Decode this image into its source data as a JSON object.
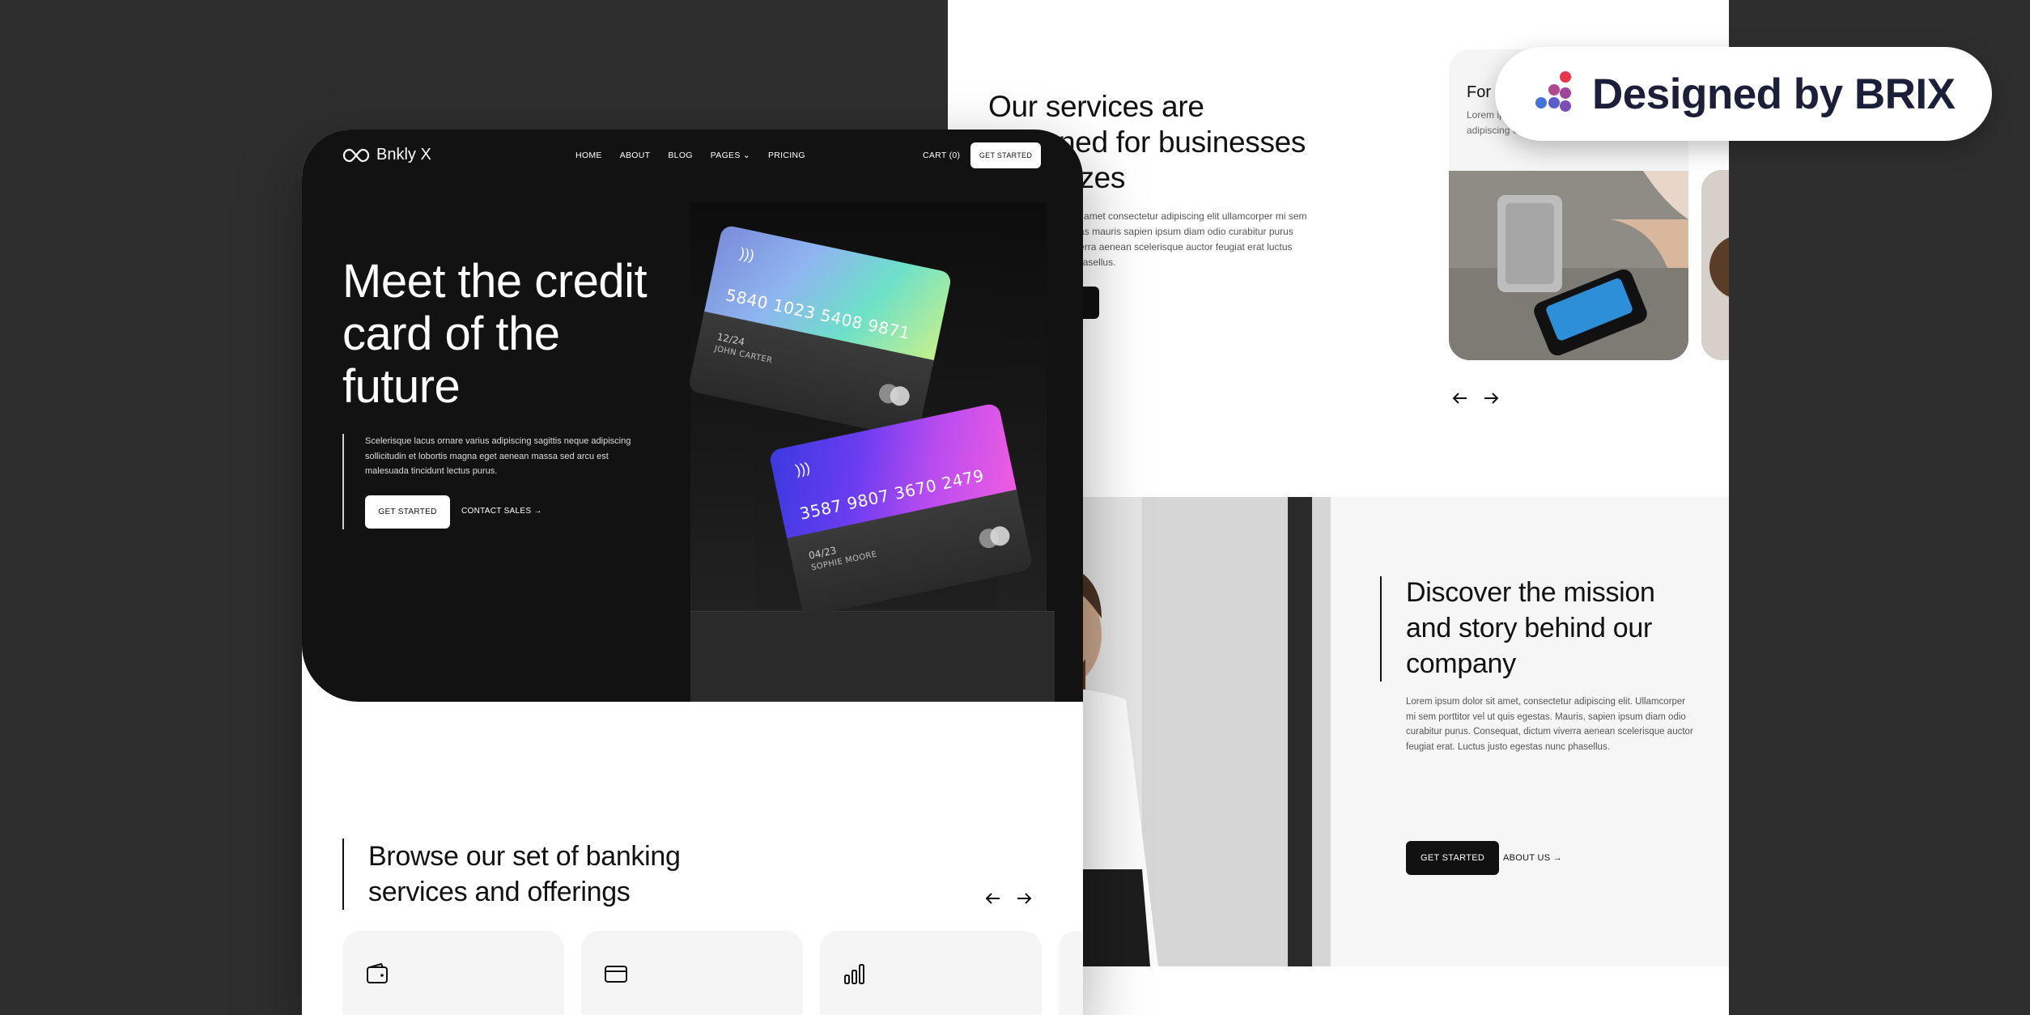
{
  "back_page": {
    "services": {
      "title": "Our services are designed for businesses of all sizes",
      "description": "Lorem ipsum dolor sit amet consectetur adipiscing elit ullamcorper mi sem porttitor ut quis egestas mauris sapien ipsum diam odio curabitur purus consequat dictum viverra aenean scelerisque auctor feugiat erat luctus justo egestas nunc phasellus.",
      "card_title": "For",
      "card_desc": "Lorem ipsum dolor sit amet consectetur adipiscing elit ullamcorper"
    },
    "mission": {
      "title": "Discover the mission and story behind our company",
      "description": "Lorem ipsum dolor sit amet, consectetur adipiscing elit. Ullamcorper mi sem porttitor vel ut quis egestas. Mauris, sapien ipsum diam odio curabitur purus. Consequat, dictum viverra aenean scelerisque auctor feugiat erat. Luctus justo egestas nunc phasellus.",
      "button_label": "GET STARTED",
      "link_label": "ABOUT US →"
    }
  },
  "badge": {
    "label": "Designed by BRIX",
    "colors": [
      "#e8354a",
      "#b3478f",
      "#7a4fb6",
      "#4574d9",
      "#2f6fe0"
    ]
  },
  "front_page": {
    "nav": {
      "logo_text": "Bnkly X",
      "links": [
        "HOME",
        "ABOUT",
        "BLOG",
        "PAGES ⌄",
        "PRICING"
      ],
      "cart": "CART (0)",
      "cta": "GET STARTED"
    },
    "hero": {
      "title": "Meet the credit card of the future",
      "description": "Scelerisque lacus ornare varius adipiscing sagittis neque adipiscing sollicitudin et lobortis magna eget aenean massa sed arcu est malesuada tincidunt lectus purus.",
      "primary_button": "GET STARTED",
      "secondary_link": "CONTACT SALES →"
    },
    "cards": [
      {
        "number": "5840 1023 5408 9871",
        "expiry": "12/24",
        "holder": "JOHN CARTER",
        "gradient": "linear-gradient(120deg,#7a8bd9 0%,#8fb5f0 35%,#6de0c8 65%,#c8f08a 100%)"
      },
      {
        "number": "3587 9807 3670 2479",
        "expiry": "04/23",
        "holder": "SOPHIE MOORE",
        "gradient": "linear-gradient(110deg,#3a3ae0 0%,#6a3cf0 35%,#b84cf0 65%,#f05ce0 100%)"
      }
    ],
    "browse": {
      "title": "Browse our set of banking services and offerings"
    },
    "offer_icons": [
      "wallet-icon",
      "credit-card-icon",
      "bar-chart-icon"
    ]
  }
}
